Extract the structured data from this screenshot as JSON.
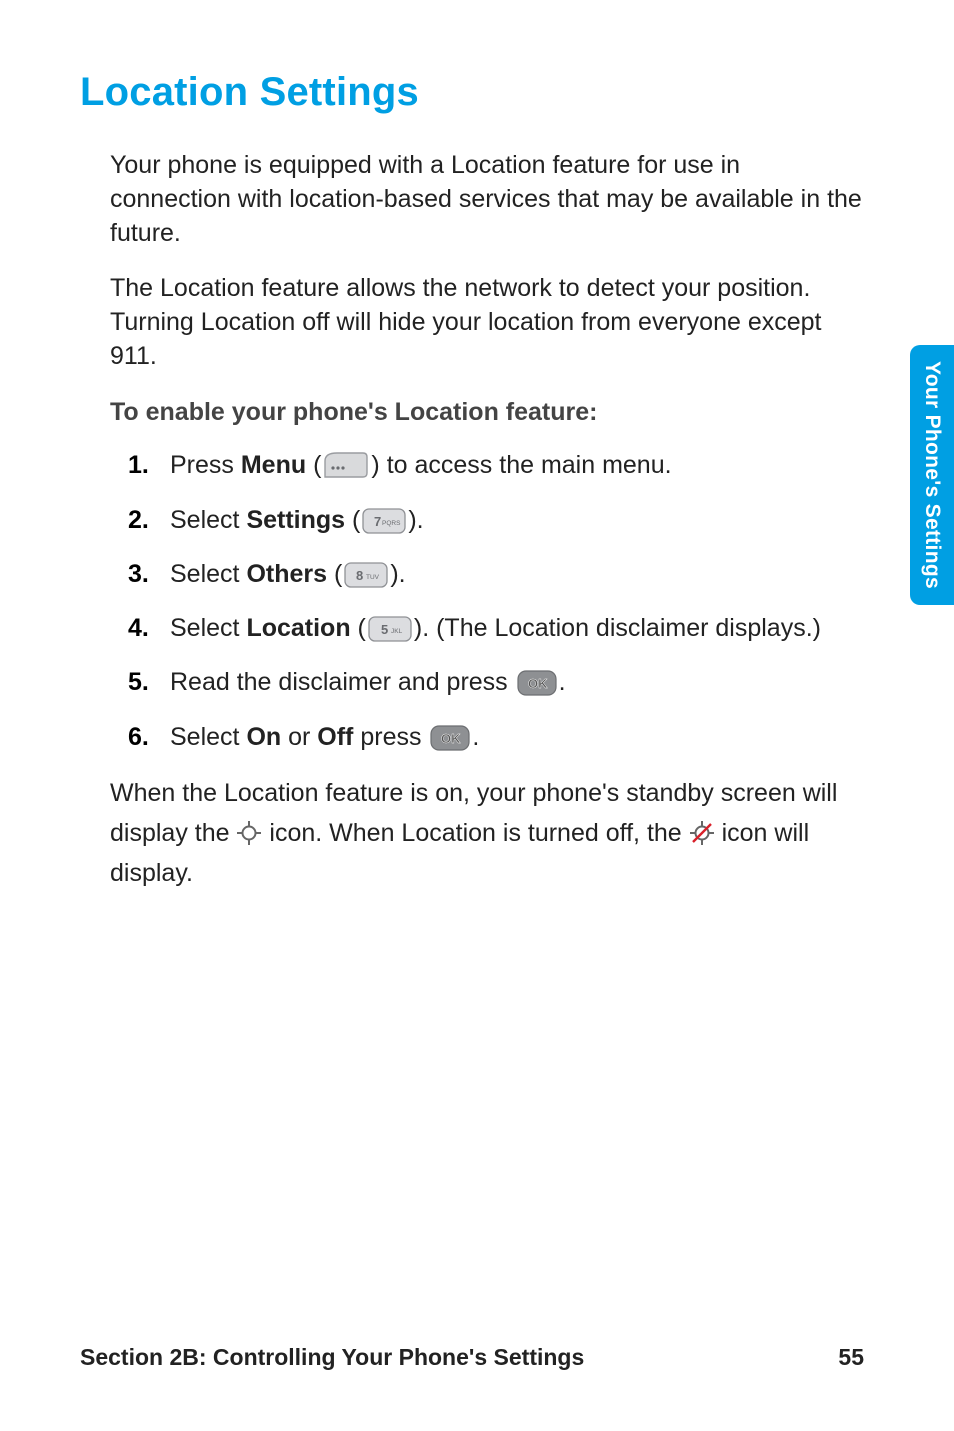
{
  "title": "Location Settings",
  "para1": "Your phone is equipped with a Location feature for use in connection with location-based services that may be available in the future.",
  "para2": "The Location feature allows the network to detect your position. Turning Location off will hide your location from everyone except 911.",
  "sub": "To enable your phone's Location feature:",
  "steps": {
    "s1a": "Press ",
    "s1b": "Menu",
    "s1c": " (",
    "s1d": ") to access the main menu.",
    "s2a": "Select ",
    "s2b": "Settings",
    "s2c": " (",
    "s2d": ").",
    "s3a": "Select ",
    "s3b": "Others",
    "s3c": " (",
    "s3d": ").",
    "s4a": "Select ",
    "s4b": "Location",
    "s4c": " (",
    "s4d": "). (The Location disclaimer displays.)",
    "s5a": "Read the disclaimer and press ",
    "s5b": ".",
    "s6a": "Select ",
    "s6b": "On",
    "s6c": " or ",
    "s6d": "Off",
    "s6e": " press ",
    "s6f": "."
  },
  "after": {
    "a1": "When the Location feature is on, your phone's standby screen will display the ",
    "a2": " icon. When Location is turned off, the ",
    "a3": " icon will display."
  },
  "side_tab": "Your Phone's Settings",
  "footer_left": "Section 2B: Controlling Your Phone's Settings",
  "footer_right": "55",
  "keys": {
    "menu": "menu-softkey",
    "k7": "7 PQRS",
    "k8": "8 TUV",
    "k5": "5 JKL",
    "ok": "OK"
  }
}
